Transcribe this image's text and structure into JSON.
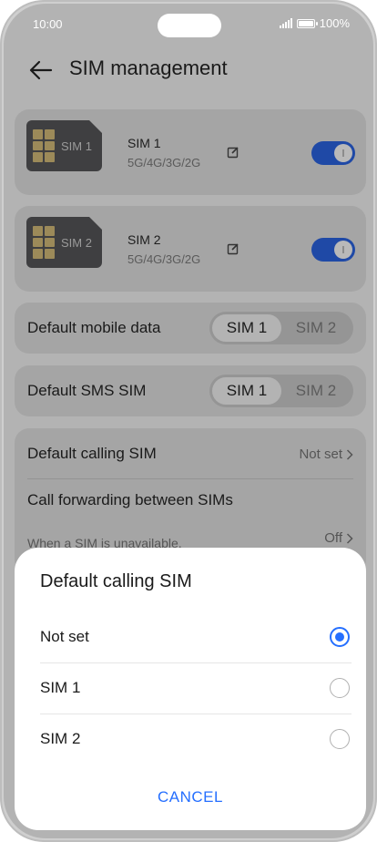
{
  "status_bar": {
    "time": "10:00",
    "battery": "100%"
  },
  "header": {
    "title": "SIM management",
    "back_icon": "arrow-left-icon"
  },
  "sims": [
    {
      "image_label": "SIM 1",
      "name": "SIM 1",
      "tech": "5G/4G/3G/2G",
      "enabled": true
    },
    {
      "image_label": "SIM 2",
      "name": "SIM 2",
      "tech": "5G/4G/3G/2G",
      "enabled": true
    }
  ],
  "default_mobile_data": {
    "label": "Default mobile data",
    "options": [
      "SIM 1",
      "SIM 2"
    ],
    "selected": "SIM 1"
  },
  "default_sms": {
    "label": "Default SMS SIM",
    "options": [
      "SIM 1",
      "SIM 2"
    ],
    "selected": "SIM 1"
  },
  "default_calling": {
    "label": "Default calling SIM",
    "value": "Not set"
  },
  "call_forwarding": {
    "label": "Call forwarding between SIMs",
    "description": "When a SIM is unavailable,",
    "value": "Off"
  },
  "dialog": {
    "title": "Default calling SIM",
    "options": [
      {
        "label": "Not set",
        "selected": true
      },
      {
        "label": "SIM 1",
        "selected": false
      },
      {
        "label": "SIM 2",
        "selected": false
      }
    ],
    "cancel_label": "CANCEL"
  },
  "colors": {
    "accent": "#256fff",
    "toggle_on": "#1f49a6",
    "scrim": "#b3b3b3"
  }
}
